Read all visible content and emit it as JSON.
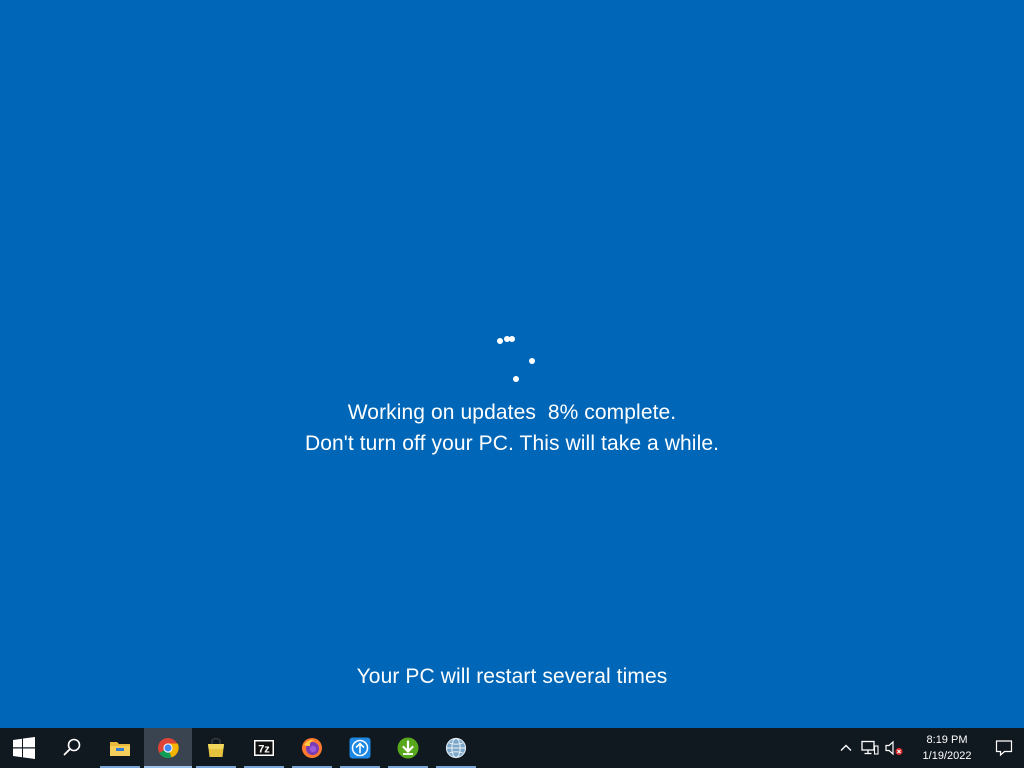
{
  "update_screen": {
    "progress_text": "Working on updates  8% complete.",
    "progress_percent": 8,
    "warning_text": "Don't turn off your PC. This will take a while.",
    "restart_text": "Your PC will restart several times",
    "background_color": "#0067b8",
    "text_color": "#ffffff"
  },
  "taskbar": {
    "background_color": "#101820",
    "apps": [
      {
        "name": "start-button",
        "icon": "windows-logo-icon"
      },
      {
        "name": "search-button",
        "icon": "search-icon"
      },
      {
        "name": "file-explorer",
        "icon": "folder-icon",
        "running": true
      },
      {
        "name": "chrome",
        "icon": "chrome-icon",
        "running": true,
        "active": true
      },
      {
        "name": "store",
        "icon": "shopping-bag-icon",
        "running": true
      },
      {
        "name": "7zip",
        "icon": "7zip-icon",
        "label": "7z",
        "running": true
      },
      {
        "name": "firefox",
        "icon": "firefox-icon",
        "running": true
      },
      {
        "name": "upload-app",
        "icon": "upload-icon",
        "running": true
      },
      {
        "name": "download-app",
        "icon": "download-icon",
        "running": true
      },
      {
        "name": "globe-app",
        "icon": "globe-icon",
        "running": true
      }
    ],
    "tray": {
      "clock_time": "8:19 PM",
      "clock_date": "1/19/2022"
    }
  }
}
